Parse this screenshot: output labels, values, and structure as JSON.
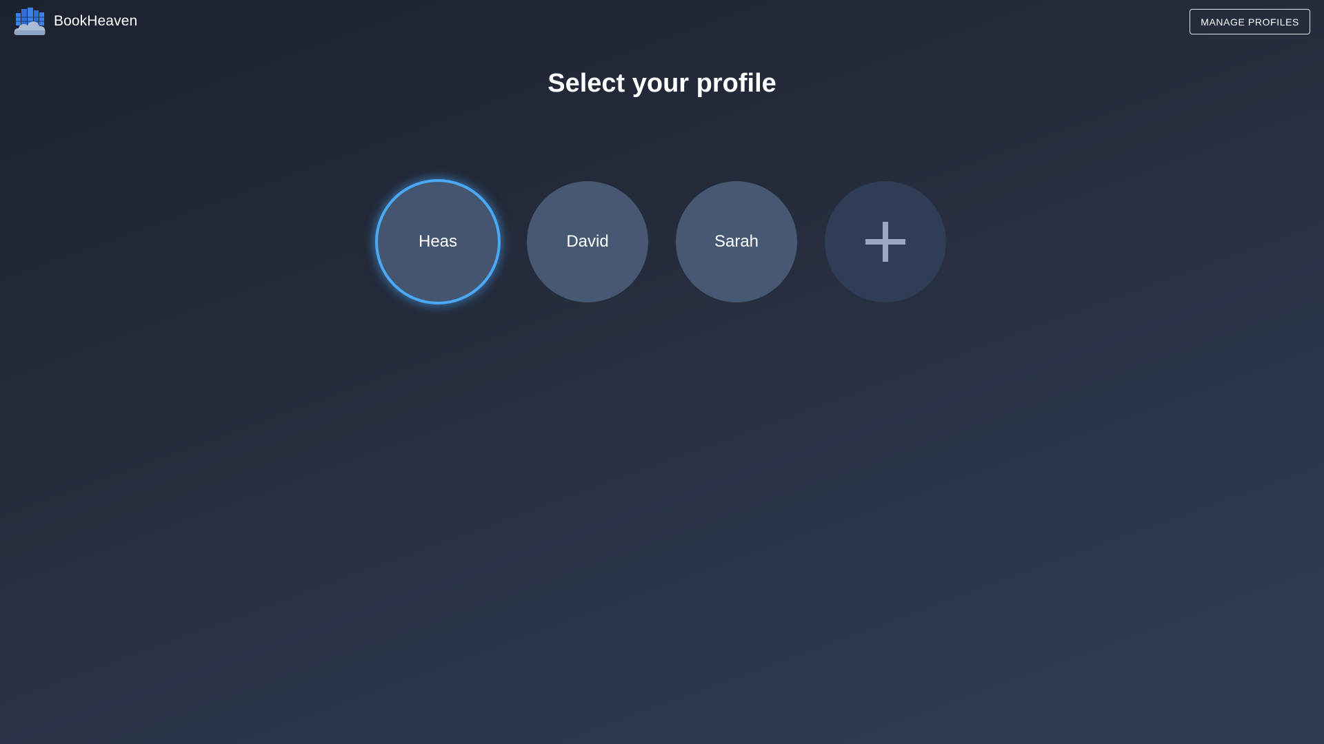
{
  "app": {
    "name": "BookHeaven",
    "logo_icon": "cloud-bookshelf-icon"
  },
  "header": {
    "manage_button_label": "MANAGE PROFILES"
  },
  "main": {
    "title": "Select your profile",
    "profiles": [
      {
        "name": "Heas",
        "selected": true
      },
      {
        "name": "David",
        "selected": false
      },
      {
        "name": "Sarah",
        "selected": false
      }
    ],
    "add_profile_icon": "plus-icon"
  },
  "colors": {
    "accent": "#4aa8f5",
    "profile_bg": "#475872",
    "add_bg": "#2f3d56",
    "plus": "#9aa8c0"
  }
}
